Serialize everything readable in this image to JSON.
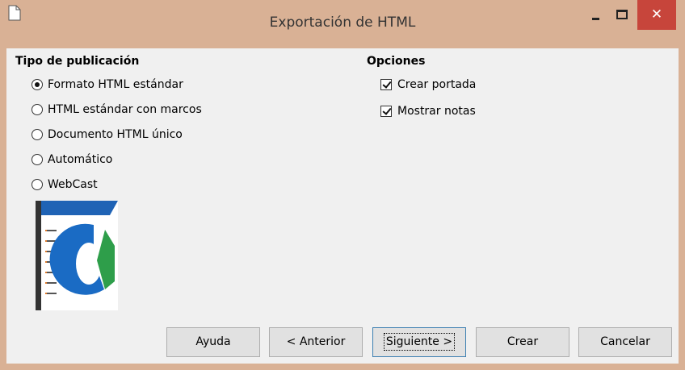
{
  "window": {
    "title": "Exportación de HTML",
    "close_symbol": "✕",
    "accent_color": "#d9b195",
    "close_color": "#c7453b"
  },
  "publication_type": {
    "heading": "Tipo de publicación",
    "options": [
      {
        "label": "Formato HTML estándar",
        "checked": true
      },
      {
        "label": "HTML estándar con marcos",
        "checked": false
      },
      {
        "label": "Documento HTML único",
        "checked": false
      },
      {
        "label": "Automático",
        "checked": false
      },
      {
        "label": "WebCast",
        "checked": false
      }
    ]
  },
  "options": {
    "heading": "Opciones",
    "items": [
      {
        "label": "Crear portada",
        "checked": true
      },
      {
        "label": "Mostrar notas",
        "checked": true
      }
    ]
  },
  "buttons": {
    "help": "Ayuda",
    "back": "< Anterior",
    "next": "Siguiente >",
    "create": "Crear",
    "cancel": "Cancelar"
  },
  "icons": {
    "app": "document-icon",
    "preview": "presentation-preview-icon"
  }
}
